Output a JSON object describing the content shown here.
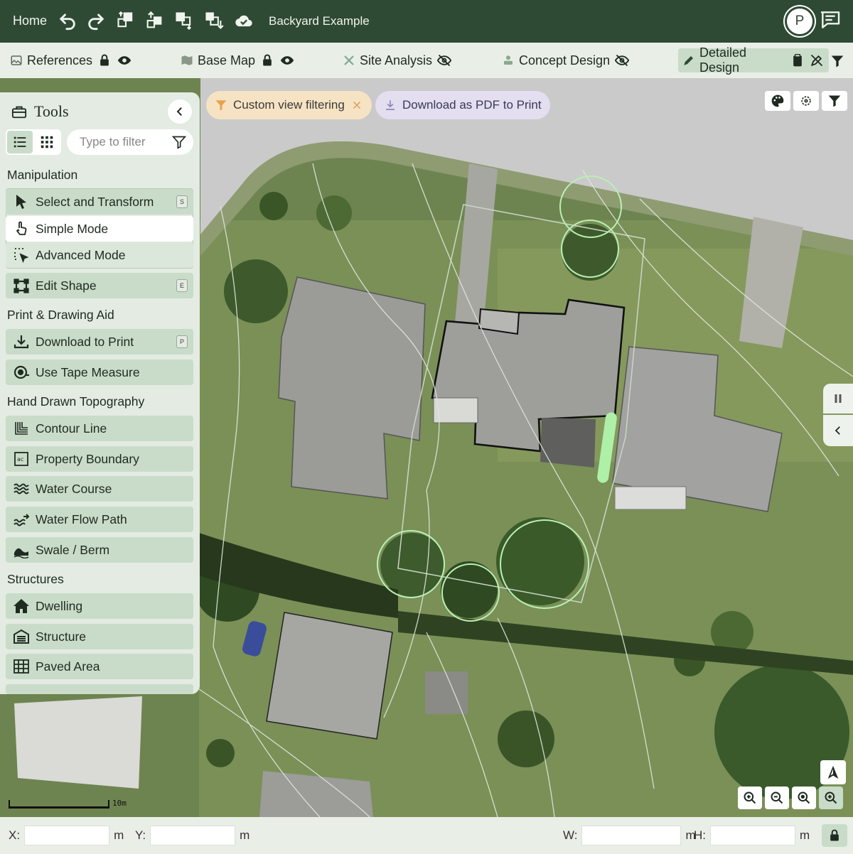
{
  "topbar": {
    "home_label": "Home",
    "project_name": "Backyard Example",
    "avatar_initial": "P",
    "icons": [
      "undo-icon",
      "redo-icon",
      "bring-forward-icon",
      "bring-to-front-icon",
      "send-backward-icon",
      "send-to-back-icon",
      "cloud-saved-icon",
      "chat-icon"
    ]
  },
  "layers": [
    {
      "label": "References",
      "icon": "image-icon",
      "state": "locked-visible"
    },
    {
      "label": "Base Map",
      "icon": "map-icon",
      "state": "locked-visible"
    },
    {
      "label": "Site Analysis",
      "icon": "analysis-icon",
      "state": "hidden"
    },
    {
      "label": "Concept Design",
      "icon": "concept-icon",
      "state": "hidden"
    },
    {
      "label": "Detailed Design",
      "icon": "pencil-icon",
      "state": "active"
    }
  ],
  "chips": {
    "filter_label": "Custom view filtering",
    "pdf_label": "Download as PDF to Print"
  },
  "tools": {
    "title": "Tools",
    "filter_placeholder": "Type to filter",
    "sections": {
      "manipulation": "Manipulation",
      "print": "Print & Drawing Aid",
      "topography": "Hand Drawn Topography",
      "structures": "Structures"
    },
    "items": {
      "select_transform": {
        "label": "Select and Transform",
        "key": "S"
      },
      "simple_mode": {
        "label": "Simple Mode"
      },
      "advanced_mode": {
        "label": "Advanced Mode"
      },
      "edit_shape": {
        "label": "Edit Shape",
        "key": "E"
      },
      "download_print": {
        "label": "Download to Print",
        "key": "P"
      },
      "tape_measure": {
        "label": "Use Tape Measure"
      },
      "contour_line": {
        "label": "Contour Line"
      },
      "property_boundary": {
        "label": "Property Boundary"
      },
      "water_course": {
        "label": "Water Course"
      },
      "water_flow_path": {
        "label": "Water Flow Path"
      },
      "swale_berm": {
        "label": "Swale / Berm"
      },
      "dwelling": {
        "label": "Dwelling"
      },
      "structure": {
        "label": "Structure"
      },
      "paved_area": {
        "label": "Paved Area"
      }
    }
  },
  "map": {
    "scale_label": "10m"
  },
  "bottombar": {
    "x_label": "X:",
    "y_label": "Y:",
    "w_label": "W:",
    "h_label": "H:",
    "unit": "m"
  },
  "colors": {
    "brand": "#2e4a34",
    "tool_bg": "#c9dcc9",
    "panel_bg": "#e3ebe2",
    "tree_outline": "#b9f0b4"
  }
}
